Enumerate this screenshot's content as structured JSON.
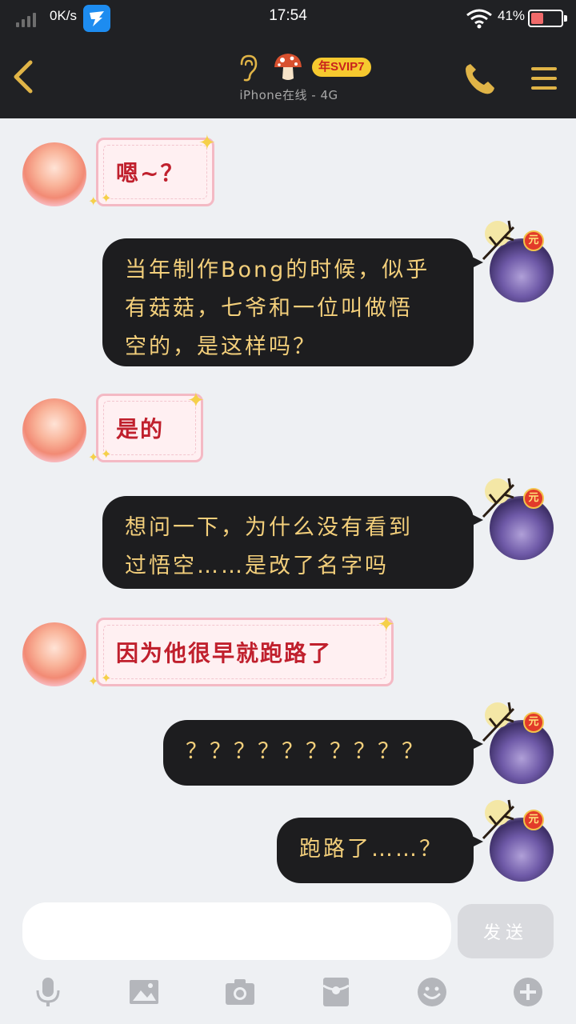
{
  "status_bar": {
    "net_speed": "0K/s",
    "time": "17:54",
    "battery_percent": "41%",
    "battery_level": 0.41
  },
  "header": {
    "subtitle": "iPhone在线 - 4G",
    "svip_badge": "年SVIP7",
    "accent_color": "#e0b447"
  },
  "messages": [
    {
      "side": "in",
      "text": "嗯~？"
    },
    {
      "side": "out",
      "lines": [
        "当年制作Bong的时候，似乎",
        "有菇菇，七爷和一位叫做悟",
        "空的，是这样吗？"
      ]
    },
    {
      "side": "in",
      "text": "是的"
    },
    {
      "side": "out",
      "lines": [
        "想问一下，为什么没有看到",
        "过悟空……是改了名字吗"
      ]
    },
    {
      "side": "in",
      "text": "因为他很早就跑路了"
    },
    {
      "side": "out",
      "lines": [
        "？？？？？？？？？？"
      ]
    },
    {
      "side": "out",
      "lines": [
        "跑路了……？"
      ]
    }
  ],
  "avatar_badge": "元",
  "input": {
    "placeholder": "",
    "value": "",
    "send_label": "发送"
  },
  "toolbar": [
    "mic-icon",
    "image-icon",
    "camera-icon",
    "red-packet-icon",
    "emoji-icon",
    "plus-icon"
  ]
}
